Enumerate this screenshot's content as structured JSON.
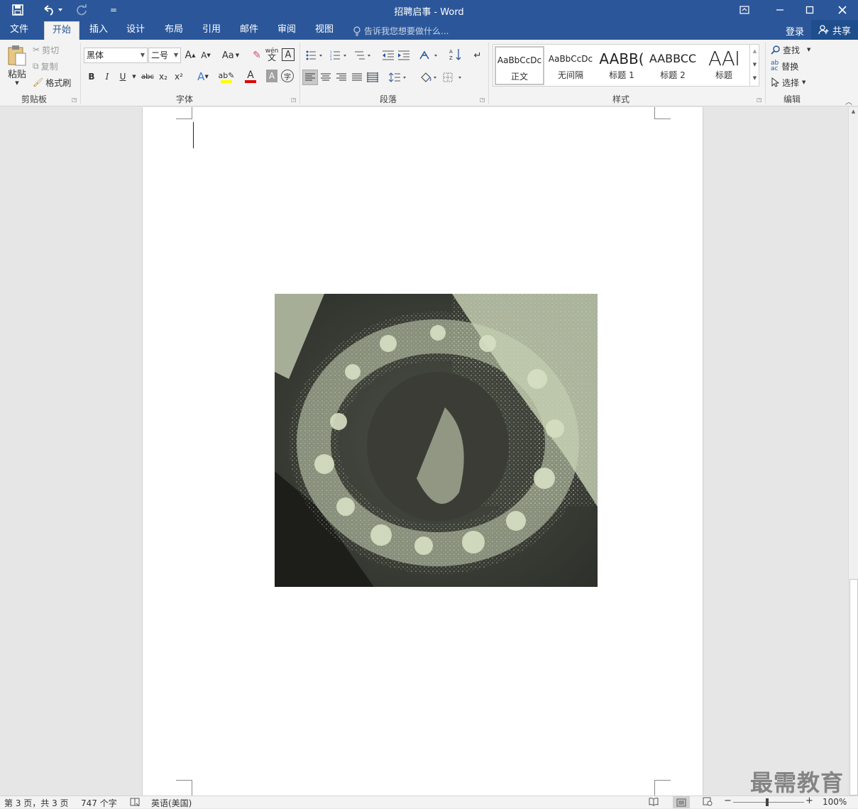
{
  "window": {
    "title": "招聘启事 - Word"
  },
  "qat": {
    "more": "="
  },
  "tabs": [
    {
      "label": "文件"
    },
    {
      "label": "开始"
    },
    {
      "label": "插入"
    },
    {
      "label": "设计"
    },
    {
      "label": "布局"
    },
    {
      "label": "引用"
    },
    {
      "label": "邮件"
    },
    {
      "label": "审阅"
    },
    {
      "label": "视图"
    }
  ],
  "tell_me": "告诉我您想要做什么...",
  "account": {
    "login": "登录",
    "share": "共享"
  },
  "clipboard": {
    "paste": "粘贴",
    "cut": "剪切",
    "copy": "复制",
    "format_painter": "格式刷",
    "group": "剪贴板"
  },
  "font": {
    "name": "黑体",
    "size": "二号",
    "change_case": "Aa",
    "bold": "B",
    "italic": "I",
    "underline": "U",
    "strike": "abc",
    "sub": "x₂",
    "sup": "x²",
    "pinyin": "wén",
    "group": "字体",
    "highlight_color": "#ffff00",
    "font_color": "#e00000"
  },
  "paragraph": {
    "group": "段落"
  },
  "styles": {
    "items": [
      {
        "preview": "AaBbCcDc",
        "name": "正文"
      },
      {
        "preview": "AaBbCcDc",
        "name": "无间隔"
      },
      {
        "preview": "AABB(",
        "name": "标题 1"
      },
      {
        "preview": "AABBCC",
        "name": "标题 2"
      },
      {
        "preview": "AAI",
        "name": "标题"
      }
    ],
    "group": "样式"
  },
  "editing": {
    "find": "查找",
    "replace": "替换",
    "select": "选择",
    "group": "编辑"
  },
  "status": {
    "page": "第 3 页，共 3 页",
    "words": "747 个字",
    "language": "英语(美国)",
    "zoom": "100%"
  },
  "watermark": "最需教育",
  "colors": {
    "ribbon_blue": "#2b579a",
    "image_tint": "#c9d3b6"
  }
}
